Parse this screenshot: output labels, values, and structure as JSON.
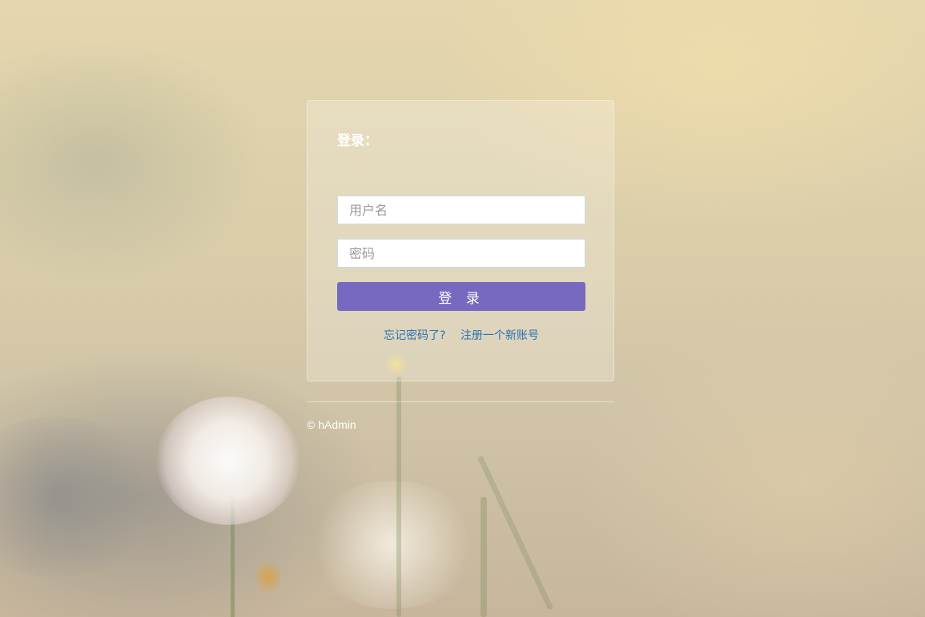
{
  "login": {
    "title": "登录：",
    "username_placeholder": "用户名",
    "password_placeholder": "密码",
    "submit_label": "登 录",
    "forgot_link": "忘记密码了?",
    "register_link": "注册一个新账号"
  },
  "footer": {
    "copyright": "© hAdmin"
  },
  "colors": {
    "button": "#7769bf",
    "link": "#2a72b5"
  }
}
